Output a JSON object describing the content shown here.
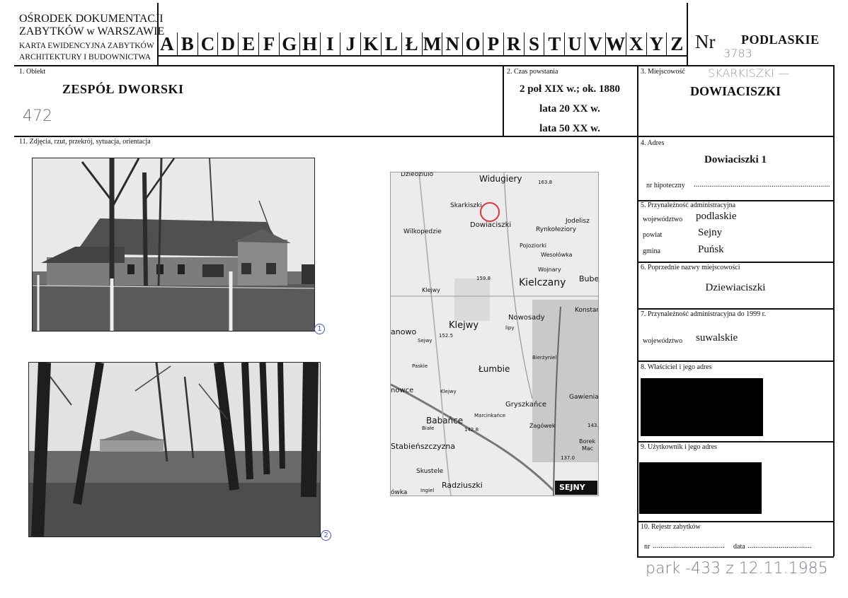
{
  "header": {
    "org_line1": "OŚRODEK DOKUMENTACJI",
    "org_line2": "ZABYTKÓW w WARSZAWIE",
    "org_line3": "KARTA EWIDENCYJNA ZABYTKÓW",
    "org_line4": "ARCHITEKTURY I BUDOWNICTWA",
    "letters": [
      "A",
      "B",
      "C",
      "D",
      "E",
      "F",
      "G",
      "H",
      "I",
      "J",
      "K",
      "L",
      "Ł",
      "M",
      "N",
      "O",
      "P",
      "R",
      "S",
      "T",
      "U",
      "V",
      "W",
      "X",
      "Y",
      "Z"
    ],
    "nr_label": "Nr",
    "region": "PODLASKIE",
    "nr_handwritten": "3783"
  },
  "obiekt": {
    "label": "1. Obiekt",
    "value": "ZESPÓŁ DWORSKI",
    "handwritten": "472"
  },
  "czas": {
    "label": "2. Czas powstania",
    "line1": "2 poł XIX w.; ok. 1880",
    "line2": "lata 20 XX w.",
    "line3": "lata 50 XX w."
  },
  "miejscowosc": {
    "label": "3. Miejscowość",
    "value": "DOWIACISZKI",
    "handwritten": "SKARKISZKI —"
  },
  "zdjecia": {
    "label": "11. Zdjęcia, rzut, przekrój, sytuacja, orientacja",
    "photo1_num": "1",
    "photo2_num": "2"
  },
  "map": {
    "labels": [
      "Dzieoziulo",
      "Widugiery",
      "163.8",
      "Skarkiszki",
      "Dowiaciszki",
      "Jodelisz",
      "Wilkopedzie",
      "Rynkołeziory",
      "Pojoziorki",
      "Wesołówka",
      "Wojnary",
      "159.8",
      "Kielczany",
      "Bube",
      "Klejwy",
      "Konstant",
      "Nowosady",
      "lipy",
      "Klejwy",
      "anowo",
      "152.5",
      "Sejwy",
      "Paskie",
      "Bierżyniel",
      "Łumbie",
      "nowce",
      "Klejwy",
      "Gawienia",
      "Gryszkańce",
      "Marcinkańce",
      "Babańce",
      "Białe",
      "142.8",
      "Żagówek",
      "143.0",
      "Stabieńszczyzna",
      "Borek",
      "Mac",
      "137.0",
      "Skustele",
      "Radziuszki",
      "Ingiel",
      "ówka",
      "SEJNY"
    ]
  },
  "adres": {
    "label": "4. Adres",
    "value": "Dowiaciszki 1",
    "hipoteczny_label": "nr hipoteczny",
    "hipoteczny_dots": "......................................................................"
  },
  "przynaleznosc": {
    "label": "5. Przynależność administracyjna",
    "wojewodztwo_label": "województwo",
    "wojewodztwo": "podlaskie",
    "powiat_label": "powiat",
    "powiat": "Sejny",
    "gmina_label": "gmina",
    "gmina": "Puńsk"
  },
  "poprzednie": {
    "label": "6. Poprzednie nazwy miejscowości",
    "value": "Dziewiaciszki"
  },
  "przyn1999": {
    "label": "7. Przynależność administracyjna do 1999 r.",
    "wojewodztwo_label": "województwo",
    "wojewodztwo": "suwalskie"
  },
  "wlasciciel": {
    "label": "8. Właściciel i jego adres"
  },
  "uzytkownik": {
    "label": "9. Użytkownik i jego adres"
  },
  "rejestr": {
    "label": "10. Rejestr zabytków",
    "nr_label": "nr",
    "nr_dots": ".....................................",
    "data_label": "data",
    "data_dots": ".................................",
    "handwritten": "park -433 z 12.11.1985"
  }
}
